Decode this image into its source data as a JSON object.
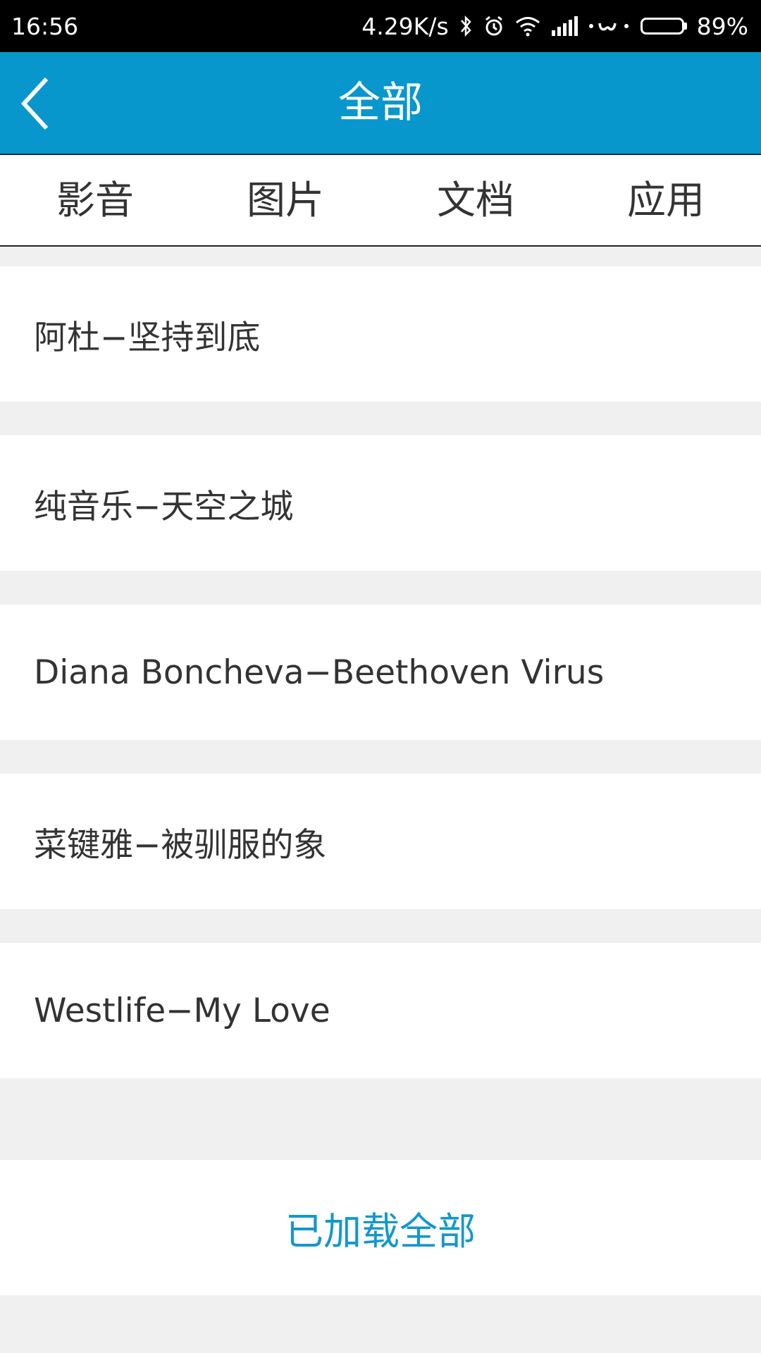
{
  "status_bar": {
    "time": "16:56",
    "net_speed": "4.29K/s",
    "battery_percent": "89%",
    "battery_level": 0.89,
    "icons": [
      "bluetooth-icon",
      "alarm-icon",
      "wifi-icon",
      "signal-icon",
      "miui-dot-icon",
      "battery-icon"
    ]
  },
  "header": {
    "title": "全部",
    "back_icon": "chevron-left-icon",
    "background_color": "#0897cc"
  },
  "tabs": [
    {
      "label": "影音"
    },
    {
      "label": "图片"
    },
    {
      "label": "文档"
    },
    {
      "label": "应用"
    }
  ],
  "list": {
    "items": [
      {
        "title": "阿杜−坚持到底"
      },
      {
        "title": "纯音乐−天空之城"
      },
      {
        "title": "Diana Boncheva−Beethoven Virus"
      },
      {
        "title": "菜键雅−被驯服的象"
      },
      {
        "title": "Westlife−My Love"
      }
    ]
  },
  "footer": {
    "text": "已加载全部",
    "color": "#1497cc"
  }
}
